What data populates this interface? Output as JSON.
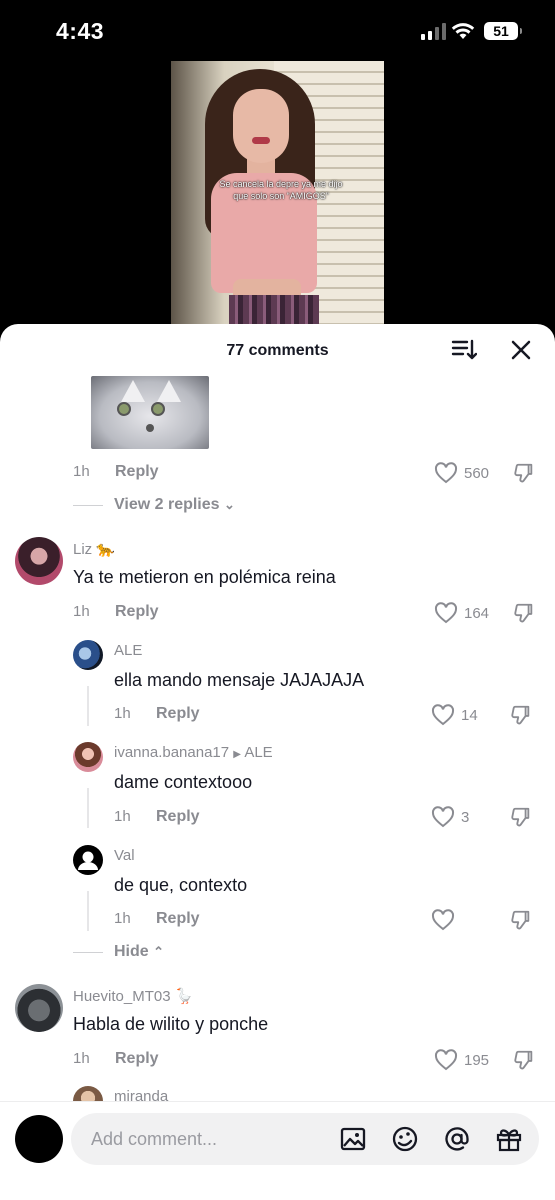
{
  "status_bar": {
    "time": "4:43",
    "battery": "51",
    "signal_bars_active": 2
  },
  "video": {
    "caption": "Se cancela la depre ya me dijo que solo son “AMIGOS”"
  },
  "header": {
    "count": "77 comments",
    "sort_icon": "sort-icon",
    "close_icon": "close-icon"
  },
  "comments": [
    {
      "id": "c0",
      "time": "1h",
      "reply": "Reply",
      "likes": "560",
      "view_replies": "View 2 replies",
      "has_gif": true
    },
    {
      "id": "c1",
      "user": "Liz 🐆",
      "text": "Ya te metieron en polémica reina",
      "time": "1h",
      "reply": "Reply",
      "likes": "164",
      "replies": [
        {
          "user": "ALE",
          "text": "ella mando mensaje JAJAJAJA",
          "time": "1h",
          "reply": "Reply",
          "likes": "14"
        },
        {
          "user": "ivanna.banana17",
          "reply_to": "ALE",
          "text": "dame contextooo",
          "time": "1h",
          "reply": "Reply",
          "likes": "3"
        },
        {
          "user": "Val",
          "text": "de que, contexto",
          "time": "1h",
          "reply": "Reply",
          "likes": ""
        }
      ],
      "hide": "Hide"
    },
    {
      "id": "c2",
      "user": "Huevito_MT03 🪿",
      "text": "Habla de wilito y ponche",
      "time": "1h",
      "reply": "Reply",
      "likes": "195"
    },
    {
      "id": "c3",
      "user": "miranda"
    }
  ],
  "composer": {
    "placeholder": "Add comment...",
    "icons": [
      "image-icon",
      "emoji-icon",
      "mention-icon",
      "gift-icon"
    ]
  }
}
